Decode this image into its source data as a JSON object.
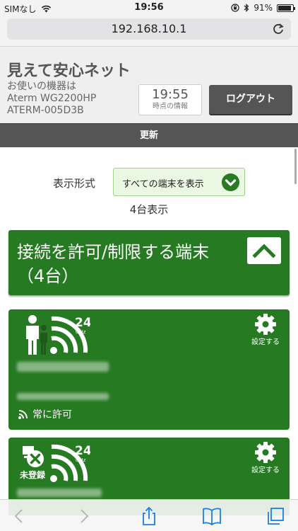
{
  "status_bar": {
    "carrier": "SIMなし",
    "time": "19:56",
    "battery": "91%",
    "battery_level": 0.91
  },
  "browser": {
    "url": "192.168.10.1"
  },
  "header": {
    "brand": "見えて安心ネット",
    "device_label": "お使いの機器は",
    "device_model": "Aterm WG2200HP",
    "device_id": "ATERM-005D3B",
    "info_time": "19:55",
    "info_time_label": "時点の情報",
    "logout_label": "ログアウト",
    "refresh_label": "更新"
  },
  "display": {
    "label": "表示形式",
    "selected": "すべての端末を表示",
    "count_text": "4台表示"
  },
  "group": {
    "title_line1": "接続を許可/制限する端末",
    "title_line2": "（4台）"
  },
  "devices": [
    {
      "band": "24",
      "band_unit": "GHz",
      "settings_label": "設定する",
      "permission": "常に許可"
    },
    {
      "band": "24",
      "band_unit": "GHz",
      "settings_label": "設定する",
      "status": "未登録"
    }
  ],
  "colors": {
    "green": "#267a22",
    "dark_gray": "#555555",
    "select_bg": "#eaf7e3"
  }
}
